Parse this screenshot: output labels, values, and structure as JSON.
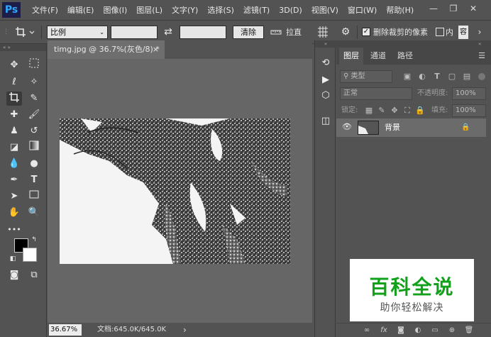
{
  "app": {
    "logo": "Ps"
  },
  "menu": [
    "文件(F)",
    "编辑(E)",
    "图像(I)",
    "图层(L)",
    "文字(Y)",
    "选择(S)",
    "滤镜(T)",
    "3D(D)",
    "视图(V)",
    "窗口(W)",
    "帮助(H)"
  ],
  "window_controls": {
    "minimize": "—",
    "restore": "❐",
    "close": "✕"
  },
  "options": {
    "crop_icon": "crop-icon",
    "ratio_select": "比例",
    "width_value": "",
    "height_value": "",
    "swap_icon": "⇄",
    "clear_label": "清除",
    "straighten_label": "拉直",
    "delete_cropped_label": "删除裁剪的像素",
    "delete_cropped_checked": true,
    "content_aware_label": "内",
    "overflow_label": "容"
  },
  "document": {
    "tab_title": "timg.jpg @ 36.7%(灰色/8) *",
    "close": "×",
    "zoom": "36.67%",
    "doc_info": "文档:645.0K/645.0K",
    "arrow": "›"
  },
  "panel": {
    "tabs": [
      "图层",
      "通道",
      "路径"
    ],
    "menu_icon": "☰",
    "filter_label": "类型",
    "blend_mode": "正常",
    "opacity_label": "不透明度:",
    "opacity_value": "100%",
    "lock_label": "锁定:",
    "fill_label": "填充:",
    "fill_value": "100%",
    "layer_name": "背景"
  },
  "watermark": {
    "title": "百科全说",
    "subtitle": "助你轻松解决"
  },
  "colors": {
    "accent": "#31a8ff",
    "watermark_green": "#11a11a",
    "foreground": "#000000",
    "background": "#ffffff"
  }
}
